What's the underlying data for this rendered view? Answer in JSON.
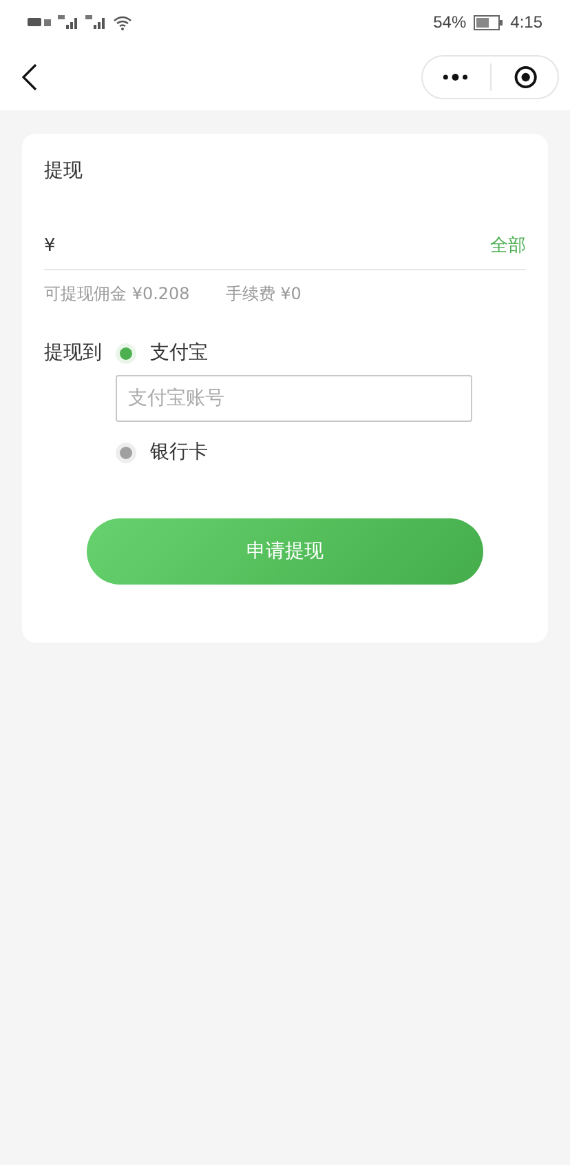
{
  "status_bar": {
    "battery": "54%",
    "time": "4:15"
  },
  "card": {
    "title": "提现",
    "amount": {
      "currency": "¥",
      "all_link": "全部"
    },
    "available": {
      "label": "可提现佣金",
      "value": "¥0.208"
    },
    "fee": {
      "label": "手续费",
      "value": "¥0"
    },
    "payout_label": "提现到",
    "options": [
      {
        "label": "支付宝",
        "selected": true,
        "account_placeholder": "支付宝账号"
      },
      {
        "label": "银行卡",
        "selected": false
      }
    ],
    "submit": "申请提现"
  }
}
